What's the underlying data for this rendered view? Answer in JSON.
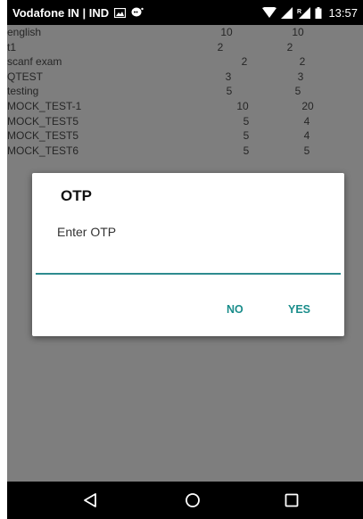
{
  "status_bar": {
    "carrier": "Vodafone IN | IND",
    "time": "13:57",
    "icons": [
      "gallery-icon",
      "messenger-icon",
      "wifi-icon",
      "signal-icon",
      "signal-roaming-icon",
      "battery-icon"
    ]
  },
  "test_list": {
    "rows": [
      {
        "name": "english",
        "a": "10",
        "b": "10"
      },
      {
        "name": "t1",
        "a": "2",
        "b": "2"
      },
      {
        "name": "scanf exam",
        "a": "2",
        "b": "2"
      },
      {
        "name": "QTEST",
        "a": "3",
        "b": "3"
      },
      {
        "name": "testing",
        "a": "5",
        "b": "5"
      },
      {
        "name": "MOCK_TEST-1",
        "a": "10",
        "b": "20"
      },
      {
        "name": "MOCK_TEST5",
        "a": "5",
        "b": "4"
      },
      {
        "name": "MOCK_TEST5",
        "a": "5",
        "b": "4"
      },
      {
        "name": "MOCK_TEST6",
        "a": "5",
        "b": "5"
      }
    ]
  },
  "dialog": {
    "title": "OTP",
    "message": "Enter OTP",
    "input_value": "",
    "no_label": "NO",
    "yes_label": "YES"
  },
  "nav_bar": {
    "icons": [
      "back-icon",
      "home-icon",
      "recents-icon"
    ]
  },
  "colors": {
    "accent": "#1a8d8b",
    "status_bar": "#000000",
    "list_background": "#f1f1f1",
    "scrim": "#000000"
  }
}
